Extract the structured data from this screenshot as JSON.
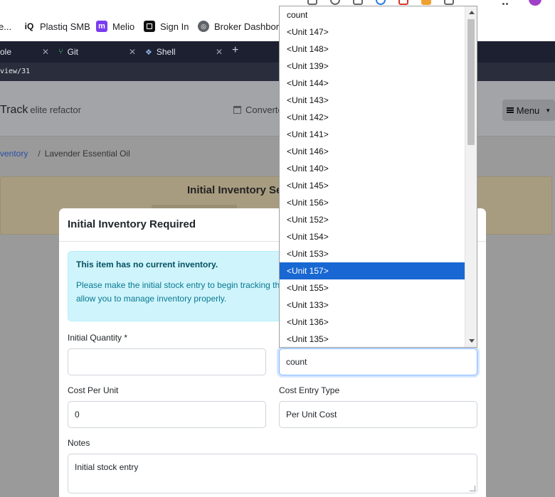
{
  "browser": {
    "bookmarks": [
      {
        "label": "e...",
        "icon": "bookmark-favicon"
      },
      {
        "label": "Plastiq SMB",
        "icon": "iq-logo-icon"
      },
      {
        "label": "Melio",
        "icon": "melio-logo-icon"
      },
      {
        "label": "Sign In",
        "icon": "square-logo-icon"
      },
      {
        "label": "Broker Dashbord",
        "icon": "globe-icon"
      }
    ],
    "tabs": [
      {
        "label": "ole"
      },
      {
        "label": "Git"
      },
      {
        "label": "Shell"
      }
    ],
    "url_fragment": "view/31"
  },
  "app": {
    "brand": "Track",
    "brand_sub": "elite refactor",
    "converter_label": "Converte",
    "menu_label": "Menu",
    "breadcrumb": {
      "parent": "ventory",
      "current": "Lavender Essential Oil"
    },
    "notice_title": "Initial Inventory Se"
  },
  "modal": {
    "title": "Initial Inventory Required",
    "alert_heading": "This item has no current inventory.",
    "alert_body": "Please make the initial stock entry to begin tracking th allow you to manage inventory properly.",
    "fields": {
      "initial_quantity": {
        "label": "Initial Quantity *",
        "value": ""
      },
      "unit": {
        "value": "count"
      },
      "cost_per_unit": {
        "label": "Cost Per Unit",
        "value": "0"
      },
      "cost_entry_type": {
        "label": "Cost Entry Type",
        "value": "Per Unit Cost"
      },
      "notes": {
        "label": "Notes",
        "value": "Initial stock entry"
      }
    }
  },
  "dropdown": {
    "options": [
      "count",
      "<Unit 147>",
      "<Unit 148>",
      "<Unit 139>",
      "<Unit 144>",
      "<Unit 143>",
      "<Unit 142>",
      "<Unit 141>",
      "<Unit 146>",
      "<Unit 140>",
      "<Unit 145>",
      "<Unit 156>",
      "<Unit 152>",
      "<Unit 154>",
      "<Unit 153>",
      "<Unit 157>",
      "<Unit 155>",
      "<Unit 133>",
      "<Unit 136>",
      "<Unit 135>"
    ],
    "highlighted_index": 15,
    "highlight_color": "#1967d2"
  }
}
